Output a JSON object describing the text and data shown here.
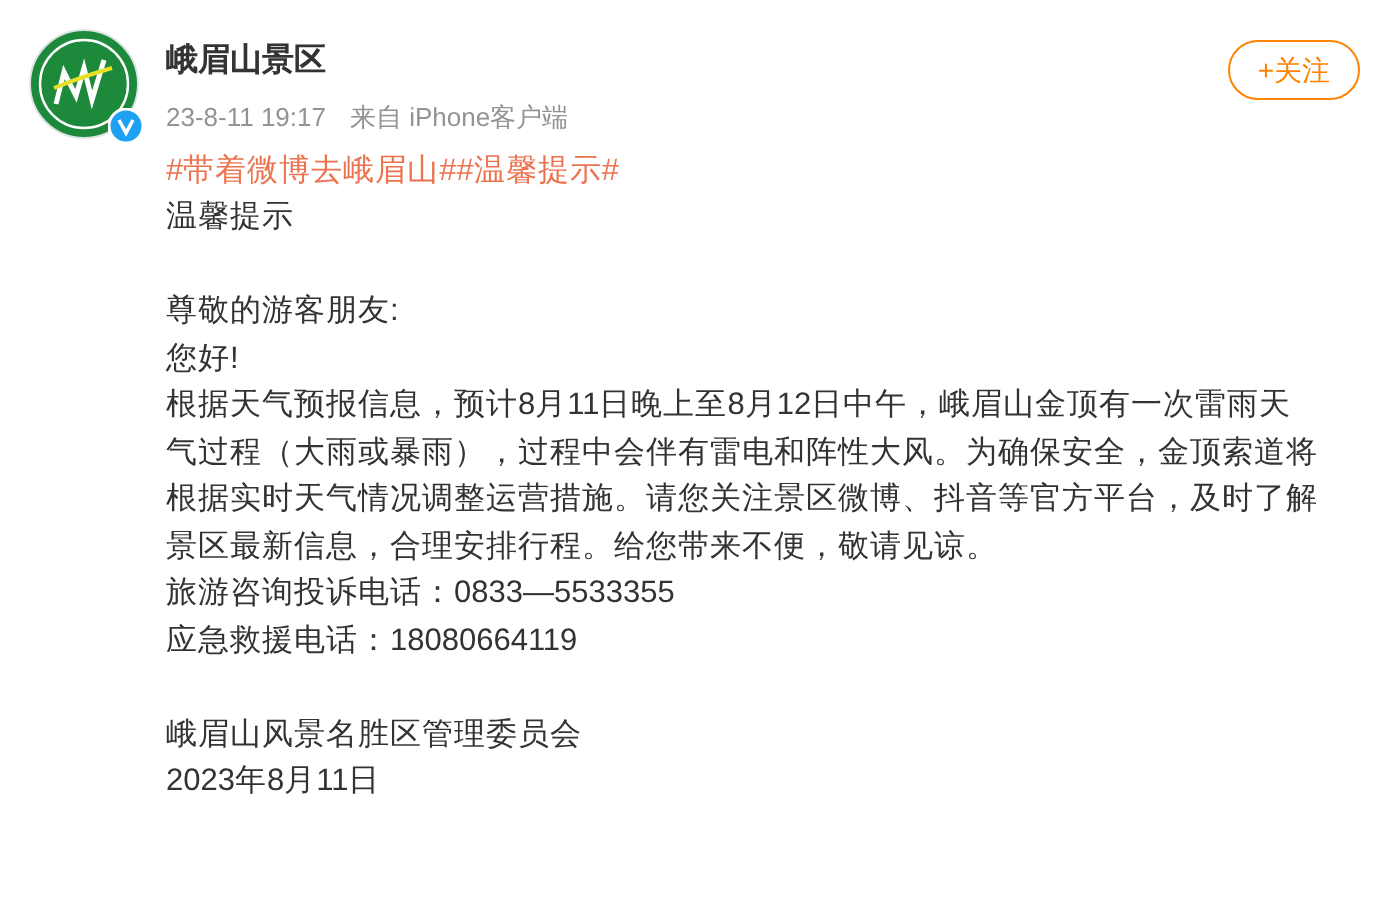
{
  "post": {
    "author": "峨眉山景区",
    "time": "23-8-11 19:17",
    "source": "来自 iPhone客户端",
    "follow_button": "+关注",
    "hashtags": [
      "#带着微博去峨眉山#",
      "#温馨提示#"
    ],
    "sections": [
      [
        "温馨提示"
      ],
      [
        "尊敬的游客朋友:",
        "您好!",
        "根据天气预报信息，预计8月11日晚上至8月12日中午，峨眉山金顶有一次雷雨天气过程（大雨或暴雨），过程中会伴有雷电和阵性大风。为确保安全，金顶索道将根据实时天气情况调整运营措施。请您关注景区微博、抖音等官方平台，及时了解景区最新信息，合理安排行程。给您带来不便，敬请见谅。",
        "旅游咨询投诉电话：0833—5533355",
        "应急救援电话：18080664119"
      ],
      [
        "峨眉山风景名胜区管理委员会",
        "2023年8月11日"
      ]
    ]
  }
}
